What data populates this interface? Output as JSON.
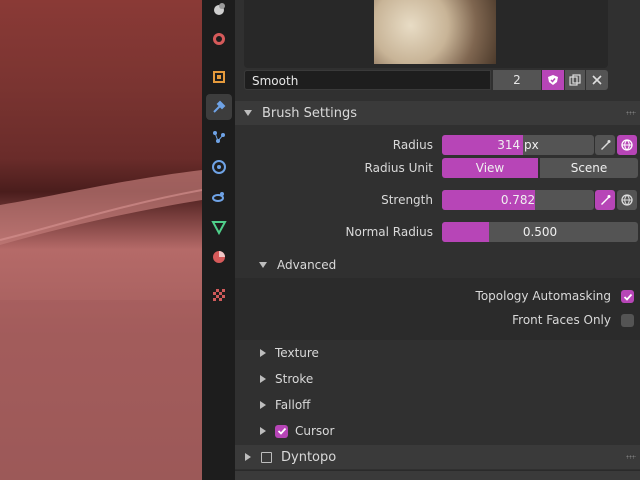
{
  "brush": {
    "name": "Smooth",
    "users": "2"
  },
  "brush_settings": {
    "title": "Brush Settings",
    "radius": {
      "label": "Radius",
      "value": "314 px",
      "fill_fraction": 0.53
    },
    "radius_unit": {
      "label": "Radius Unit",
      "options": [
        "View",
        "Scene"
      ],
      "selected": "View"
    },
    "strength": {
      "label": "Strength",
      "value": "0.782",
      "fill_fraction": 0.61
    },
    "normal_radius": {
      "label": "Normal Radius",
      "value": "0.500",
      "fill_fraction": 0.24
    }
  },
  "advanced": {
    "title": "Advanced",
    "topology_automasking": {
      "label": "Topology Automasking",
      "checked": true
    },
    "front_faces_only": {
      "label": "Front Faces Only",
      "checked": false
    }
  },
  "subpanels": [
    {
      "label": "Texture"
    },
    {
      "label": "Stroke"
    },
    {
      "label": "Falloff"
    },
    {
      "label": "Cursor",
      "checked": true
    }
  ],
  "dyntopo": {
    "label": "Dyntopo",
    "checked": false
  },
  "colors": {
    "accent": "#b745b7",
    "panel": "#303030",
    "widget": "#545454"
  },
  "tab_icons": [
    "scene-icon",
    "world-icon",
    "object-icon",
    "modifier-icon",
    "particles-icon",
    "physics-icon",
    "constraints-icon",
    "data-icon",
    "material-icon",
    "texture-icon"
  ]
}
